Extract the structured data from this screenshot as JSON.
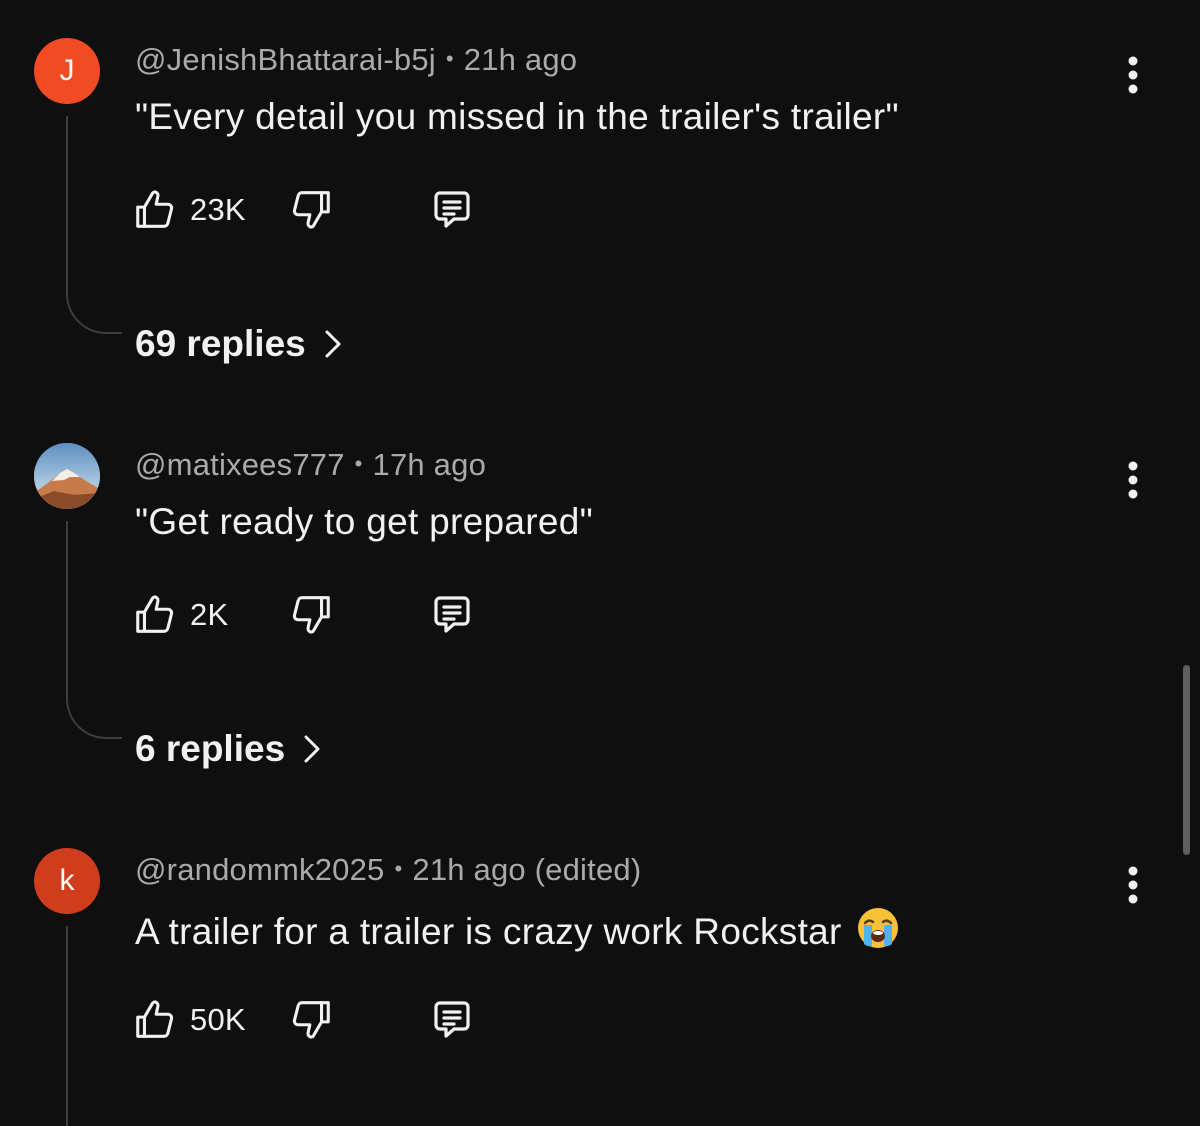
{
  "comments": [
    {
      "avatar_letter": "J",
      "avatar_color": "#f04b23",
      "author": "@JenishBhattarai-b5j",
      "time": "21h ago",
      "text": "\"Every detail you missed in the trailer's trailer\"",
      "likes": "23K",
      "replies_label": "69 replies"
    },
    {
      "avatar_letter": "",
      "avatar_color": "#7fa7c9",
      "author": "@matixees777",
      "time": "17h ago",
      "text": "\"Get ready to get prepared\"",
      "likes": "2K",
      "replies_label": "6 replies"
    },
    {
      "avatar_letter": "k",
      "avatar_color": "#d03d1d",
      "author": "@randommk2025",
      "time": "21h ago (edited)",
      "text": "A trailer for a trailer is crazy work Rockstar",
      "likes": "50K",
      "emoji": "loudly-crying-face"
    }
  ],
  "icons": {
    "like": "thumbs-up-icon",
    "dislike": "thumbs-down-icon",
    "reply": "reply-comment-icon",
    "more": "more-vertical-icon",
    "chevron": "chevron-right-icon"
  },
  "scrollbar": {
    "visible": true
  },
  "colors": {
    "background": "#0f0f0f",
    "primary_text": "#f1f1f1",
    "secondary_text": "#aaaaaa",
    "thread_line": "#3d3d3d"
  }
}
